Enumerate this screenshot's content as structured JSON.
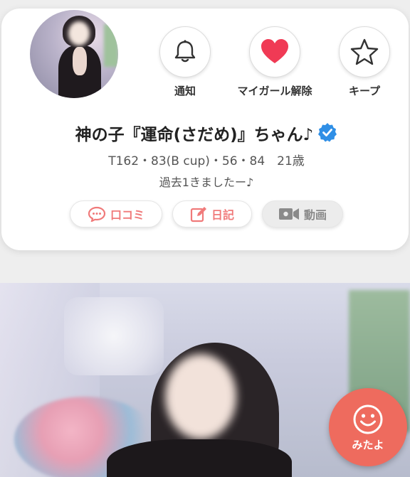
{
  "profile": {
    "name": "神の子『運命(さだめ)』ちゃん♪",
    "stats": "T162・83(B cup)・56・84　21歳",
    "comment": "過去1きましたー♪"
  },
  "actions": {
    "notify_label": "通知",
    "mygirl_label": "マイガール解除",
    "keep_label": "キープ"
  },
  "tabs": {
    "kuchikomi_label": "口コミ",
    "diary_label": "日記",
    "video_label": "動画"
  },
  "fab": {
    "label": "みたよ"
  },
  "colors": {
    "accent": "#f07a7a",
    "heart": "#f03a55",
    "verified": "#2f8fe6",
    "fab": "#ee6b5e",
    "disabled": "#8a8a8a"
  },
  "icons": [
    "bell-icon",
    "heart-icon",
    "star-icon",
    "verified-icon",
    "chat-bubble-icon",
    "edit-icon",
    "video-camera-icon",
    "smiley-icon"
  ]
}
